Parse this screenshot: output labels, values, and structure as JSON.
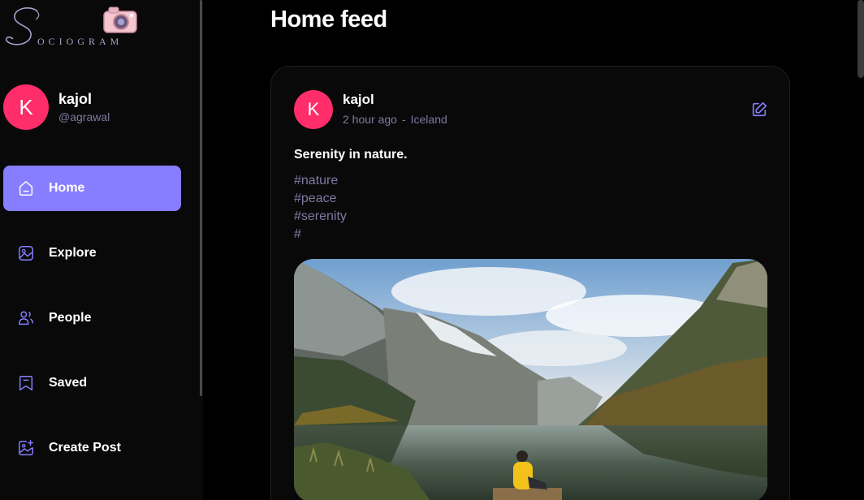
{
  "app": {
    "logo_text": "OCIOGRAM",
    "logo_initial": "S"
  },
  "profile": {
    "initial": "K",
    "name": "kajol",
    "handle": "@agrawal"
  },
  "nav": [
    {
      "label": "Home",
      "icon": "home-icon",
      "active": true
    },
    {
      "label": "Explore",
      "icon": "gallery-icon",
      "active": false
    },
    {
      "label": "People",
      "icon": "people-icon",
      "active": false
    },
    {
      "label": "Saved",
      "icon": "bookmark-icon",
      "active": false
    },
    {
      "label": "Create Post",
      "icon": "add-image-icon",
      "active": false
    }
  ],
  "main": {
    "title": "Home feed"
  },
  "post": {
    "author_initial": "K",
    "author": "kajol",
    "time": "2 hour ago",
    "separator": "-",
    "location": "Iceland",
    "caption": "Serenity in nature.",
    "tags": [
      "#nature",
      "#peace",
      "#serenity",
      "#"
    ]
  },
  "colors": {
    "accent": "#877eff",
    "avatar": "#ff2d6a",
    "muted": "#7e7aa0",
    "background": "#000000",
    "sidebar": "#09090a"
  }
}
